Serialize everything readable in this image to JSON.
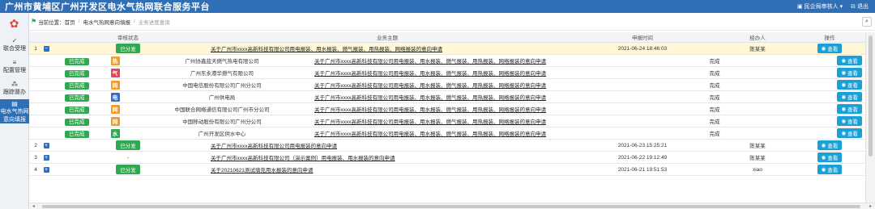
{
  "header": {
    "title": "广州市黄埔区广州开发区电水气热网联合服务平台",
    "user": "民企局审核人",
    "logout": "退出"
  },
  "sidebar": {
    "items": [
      {
        "label": "联合受理",
        "icon": "check-icon"
      },
      {
        "label": "配置管理",
        "icon": "list-icon"
      },
      {
        "label": "跟踪督办",
        "icon": "nodes-icon"
      },
      {
        "label": "电水气热网意向填报",
        "label2": "意向填报",
        "label1": "电水气热网",
        "icon": "form-icon"
      }
    ]
  },
  "breadcrumb": {
    "prefix": "当前位置：",
    "items": [
      "首页",
      "电水气热网意向填报",
      "业务进度查询"
    ]
  },
  "table": {
    "headers": [
      "审核状态",
      "业务主题",
      "申报时间",
      "经办人",
      "操作"
    ],
    "rows": [
      {
        "idx": "1",
        "expander": "−",
        "status": "已分发",
        "topic": "关于广州市xxxx高新科技有限公司用电报装、用水报装、燃气报装、用热报装、网络报装的意向申请",
        "time": "2021-06-24 18:46:03",
        "handler": "陈某某",
        "op": "查看"
      }
    ],
    "subrows": [
      {
        "status": "已完成",
        "type": "热",
        "color": "#f0a020",
        "org": "广州协鑫蓝天燃气热电有限公司",
        "topic": "关于广州市xxxx高新科技有限公司用电报装、用水报装、燃气报装、用热报装、网络报装的意向申请",
        "state": "完成",
        "op": "查看"
      },
      {
        "status": "已完成",
        "type": "气",
        "color": "#e8445a",
        "org": "广州东永港华燃气有限公司",
        "topic": "关于广州市xxxx高新科技有限公司用电报装、用水报装、燃气报装、用热报装、网络报装的意向申请",
        "state": "完成",
        "op": "查看"
      },
      {
        "status": "已完成",
        "type": "网",
        "color": "#f39b2a",
        "org": "中国电信股份有限公司广州分公司",
        "topic": "关于广州市xxxx高新科技有限公司用电报装、用水报装、燃气报装、用热报装、网络报装的意向申请",
        "state": "完成",
        "op": "查看"
      },
      {
        "status": "已完成",
        "type": "电",
        "color": "#2f6fd6",
        "org": "广州供电局",
        "topic": "关于广州市xxxx高新科技有限公司用电报装、用水报装、燃气报装、用热报装、网络报装的意向申请",
        "state": "完成",
        "op": "查看"
      },
      {
        "status": "已完成",
        "type": "网",
        "color": "#f39b2a",
        "org": "中国联合网络通信有限公司广州市分公司",
        "topic": "关于广州市xxxx高新科技有限公司用电报装、用水报装、燃气报装、用热报装、网络报装的意向申请",
        "state": "完成",
        "op": "查看"
      },
      {
        "status": "已完成",
        "type": "网",
        "color": "#f39b2a",
        "org": "中国移动股份有限公司广州分公司",
        "topic": "关于广州市xxxx高新科技有限公司用电报装、用水报装、燃气报装、用热报装、网络报装的意向申请",
        "state": "完成",
        "op": "查看"
      },
      {
        "status": "已完成",
        "type": "水",
        "color": "#2fa84f",
        "org": "广州开发区供水中心",
        "topic": "关于广州市xxxx高新科技有限公司用电报装、用水报装、燃气报装、用热报装、网络报装的意向申请",
        "state": "完成",
        "op": "查看"
      }
    ],
    "rows_after": [
      {
        "idx": "2",
        "expander": "+",
        "status": "已分发",
        "topic": "关于广州市xxxx高新科技有限公司用电报装的意向申请",
        "time": "2021-06-23 15:25:21",
        "handler": "陈某某",
        "op": "查看"
      },
      {
        "idx": "3",
        "expander": "+",
        "status": "-",
        "topic": "关于广州市xxxx高新科技有限公司（演示案例）用电报装、用水报装的意向申请",
        "time": "2021-06-22 19:12:49",
        "handler": "陈某某",
        "op": "查看"
      },
      {
        "idx": "4",
        "expander": "+",
        "status": "已分发",
        "topic": "关于20210621测试填充用水报装的意向申请",
        "time": "2021-06-21 19:51:53",
        "handler": "xiao",
        "op": "查看"
      }
    ]
  }
}
